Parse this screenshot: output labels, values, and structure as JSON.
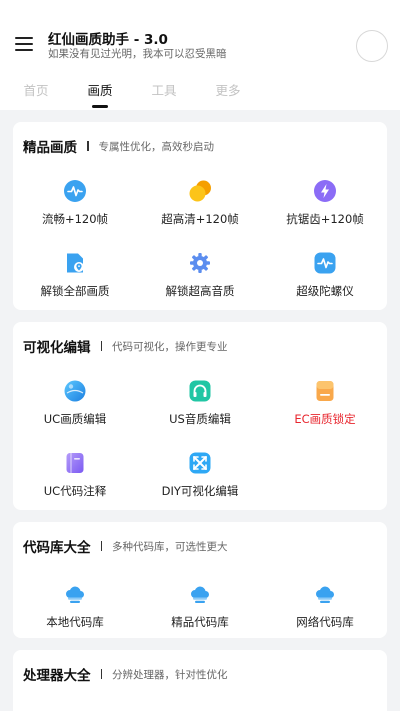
{
  "header": {
    "title": "红仙画质助手 - 3.0",
    "subtitle": "如果没有见过光明，我本可以忍受黑暗",
    "menu_icon": "hamburger-menu-icon",
    "avatar_icon": "avatar-circle"
  },
  "tabs": [
    {
      "label": "首页",
      "active": false
    },
    {
      "label": "画质",
      "active": true
    },
    {
      "label": "工具",
      "active": false
    },
    {
      "label": "更多",
      "active": false
    }
  ],
  "sections": [
    {
      "title": "精品画质",
      "desc": "专属性优化，高效秒启动",
      "items": [
        {
          "label": "流畅+120帧",
          "icon": "pulse-icon"
        },
        {
          "label": "超高清+120帧",
          "icon": "double-circle-icon"
        },
        {
          "label": "抗锯齿+120帧",
          "icon": "lightning-icon"
        },
        {
          "label": "解锁全部画质",
          "icon": "file-location-icon"
        },
        {
          "label": "解锁超高音质",
          "icon": "gear-icon"
        },
        {
          "label": "超级陀螺仪",
          "icon": "pulse-icon"
        }
      ]
    },
    {
      "title": "可视化编辑",
      "desc": "代码可视化，操作更专业",
      "items": [
        {
          "label": "UC画质编辑",
          "icon": "sphere-icon"
        },
        {
          "label": "US音质编辑",
          "icon": "headset-icon"
        },
        {
          "label": "EC画质锁定",
          "icon": "note-icon",
          "highlight": true
        },
        {
          "label": "UC代码注释",
          "icon": "book-icon"
        },
        {
          "label": "DIY可视化编辑",
          "icon": "expand-icon"
        }
      ]
    },
    {
      "title": "代码库大全",
      "desc": "多种代码库，可选性更大",
      "items": [
        {
          "label": "本地代码库",
          "icon": "cloud-icon"
        },
        {
          "label": "精品代码库",
          "icon": "cloud-icon"
        },
        {
          "label": "网络代码库",
          "icon": "cloud-icon"
        }
      ]
    },
    {
      "title": "处理器大全",
      "desc": "分辨处理器，针对性优化",
      "items": []
    }
  ],
  "colors": {
    "accent_blue": "#3aa2f0",
    "accent_yellow": "#fcc419",
    "accent_purple": "#8b6cf6",
    "accent_teal": "#21c6a4",
    "highlight_red": "#e8262e",
    "background": "#f2f3f5"
  }
}
